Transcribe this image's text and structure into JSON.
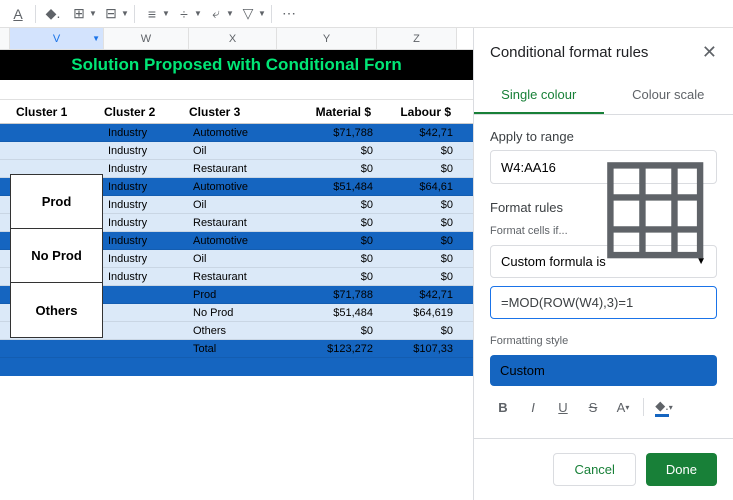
{
  "toolbar": {
    "more": "⋯"
  },
  "columns": [
    "V",
    "W",
    "X",
    "Y",
    "Z"
  ],
  "title_row": "Solution Proposed with Conditional Forn",
  "headers": {
    "c1": "Cluster 1",
    "c2": "Cluster 2",
    "c3": "Cluster 3",
    "c4": "Material $",
    "c5": "Labour $"
  },
  "clusters": [
    "Prod",
    "No Prod",
    "Others"
  ],
  "rows": [
    {
      "hl": true,
      "c2": "Industry",
      "c3": "Automotive",
      "c4": "$71,788",
      "c5": "$42,71"
    },
    {
      "hl": false,
      "c2": "Industry",
      "c3": "Oil",
      "c4": "$0",
      "c5": "$0"
    },
    {
      "hl": false,
      "c2": "Industry",
      "c3": "Restaurant",
      "c4": "$0",
      "c5": "$0"
    },
    {
      "hl": true,
      "c2": "Industry",
      "c3": "Automotive",
      "c4": "$51,484",
      "c5": "$64,61"
    },
    {
      "hl": false,
      "c2": "Industry",
      "c3": "Oil",
      "c4": "$0",
      "c5": "$0"
    },
    {
      "hl": false,
      "c2": "Industry",
      "c3": "Restaurant",
      "c4": "$0",
      "c5": "$0"
    },
    {
      "hl": true,
      "c2": "Industry",
      "c3": "Automotive",
      "c4": "$0",
      "c5": "$0"
    },
    {
      "hl": false,
      "c2": "Industry",
      "c3": "Oil",
      "c4": "$0",
      "c5": "$0"
    },
    {
      "hl": false,
      "c2": "Industry",
      "c3": "Restaurant",
      "c4": "$0",
      "c5": "$0"
    },
    {
      "hl": true,
      "c2": "",
      "c3": "Prod",
      "c4": "$71,788",
      "c5": "$42,71"
    },
    {
      "hl": false,
      "c2": "",
      "c3": "No Prod",
      "c4": "$51,484",
      "c5": "$64,619"
    },
    {
      "hl": false,
      "c2": "",
      "c3": "Others",
      "c4": "$0",
      "c5": "$0"
    },
    {
      "hl": true,
      "c2": "",
      "c3": "Total",
      "c4": "$123,272",
      "c5": "$107,33"
    }
  ],
  "panel": {
    "title": "Conditional format rules",
    "tab1": "Single colour",
    "tab2": "Colour scale",
    "apply_label": "Apply to range",
    "range": "W4:AA16",
    "rules_title": "Format rules",
    "cells_if": "Format cells if...",
    "condition": "Custom formula is",
    "formula": "=MOD(ROW(W4),3)=1",
    "style_title": "Formatting style",
    "style_name": "Custom",
    "cancel": "Cancel",
    "done": "Done"
  }
}
